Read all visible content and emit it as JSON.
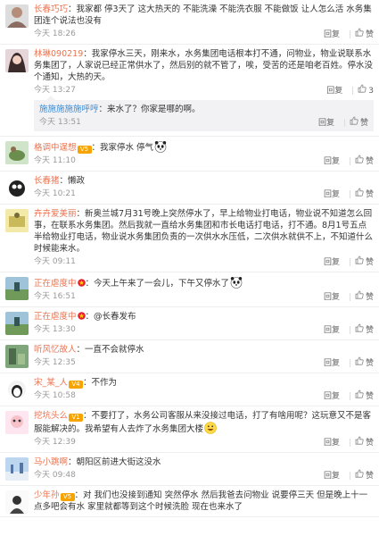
{
  "actions": {
    "reply": "回复",
    "like": "赞"
  },
  "colors": {
    "username": "#eb7350",
    "username_blue": "#3b8bd2",
    "timestamp": "#999999",
    "reply_bg": "#f2f2f5"
  },
  "comments": [
    {
      "user": "长春巧巧",
      "text": "我家都 停3天了 这大热天的 不能洗澡 不能洗衣服 不能做饭 让人怎么活 水务集团连个说法也没有",
      "time": "今天 18:26",
      "likes": ""
    },
    {
      "user": "林琳090219",
      "text": "我家停水三天，刚来水，水务集团电话根本打不通，问物业，物业说联系水务集团了，人家说已经正常供水了，然后别的就不管了，唉，受苦的还是咱老百姓。停水没个通知，大热的天。",
      "time": "今天 13:27",
      "likes": "3",
      "reply": {
        "user": "施施施施施呼哼",
        "text": "来水了？你家是哪的啊。",
        "time": "今天 13:51"
      }
    },
    {
      "user": "格调中逞想",
      "text": "我家停水 停气",
      "time": "今天 11:10",
      "likes": "",
      "vip": "V5"
    },
    {
      "user": "长春猪",
      "text": "懒政",
      "time": "今天 10:21",
      "likes": ""
    },
    {
      "user": "卉卉爱美丽",
      "text": "新奥兰城7月31号晚上突然停水了，早上给物业打电话，物业说不知道怎么回事，在联系水务集团。然后我就一直给水务集团和市长电话打电话，打不通。8月1号五点半给物业打电话，物业说水务集团负责的一次供水水压低，二次供水就供不上，不知道什么时候能来水。",
      "time": "今天 09:11",
      "likes": ""
    },
    {
      "user": "正在虐度中",
      "text": "今天上午来了一会儿，下午又停水了",
      "time": "今天 16:51",
      "likes": ""
    },
    {
      "user": "正在虐度中",
      "text": "@长春发布",
      "time": "今天 13:30",
      "likes": ""
    },
    {
      "user": "听风忆故人",
      "text": "一直不会就停水",
      "time": "今天 12:35",
      "likes": ""
    },
    {
      "user": "宋_某_人",
      "text": "不作为",
      "time": "今天 10:58",
      "likes": "",
      "vip": "V4"
    },
    {
      "user": "挖坑头么",
      "text": "不要打了，水务公司客服从来没接过电话，打了有啥用呢？这玩意又不是客服能解决的。我希望有人去炸了水务集团大楼",
      "time": "今天 12:39",
      "likes": "",
      "vip": "V1"
    },
    {
      "user": "马小跳啊",
      "text": "朝阳区前进大街这没水",
      "time": "今天 09:48",
      "likes": ""
    },
    {
      "user": "少年孙",
      "text": "对 我们也没接到通知 突然停水 然后我爸去问物业 说要停三天 但是晚上十一点多吧会有水 家里就都等到这个时候洗脸 现在也来水了",
      "time": "",
      "likes": "",
      "vip": "V5"
    }
  ]
}
